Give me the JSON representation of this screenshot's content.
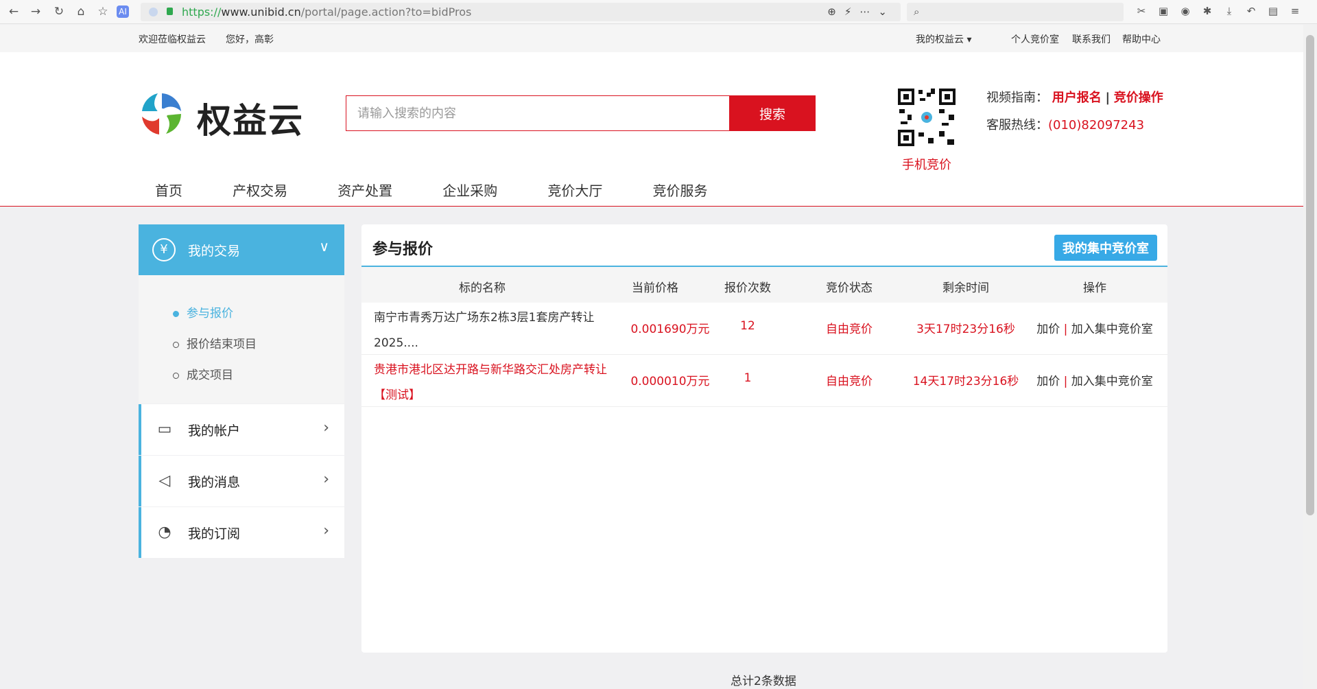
{
  "browser": {
    "url_scheme": "https://",
    "url_host": "www.unibid.cn",
    "url_path": "/portal/page.action?to=bidPros"
  },
  "topbar": {
    "welcome": "欢迎莅临权益云",
    "greeting": "您好，高彰",
    "my_cloud": "我的权益云",
    "links": [
      "个人竞价室",
      "联系我们",
      "帮助中心"
    ]
  },
  "header": {
    "logo_text": "权益云",
    "search_placeholder": "请输入搜索的内容",
    "search_button": "搜索",
    "qr_caption": "手机竞价",
    "guide_label": "视频指南：",
    "guide_link1": "用户报名",
    "guide_sep": "|",
    "guide_link2": "竞价操作",
    "hotline_label": "客服热线：",
    "hotline_number": "(010)82097243"
  },
  "nav": [
    "首页",
    "产权交易",
    "资产处置",
    "企业采购",
    "竞价大厅",
    "竞价服务"
  ],
  "sidebar": {
    "section_title": "我的交易",
    "sub_items": [
      "参与报价",
      "报价结束项目",
      "成交项目"
    ],
    "rows": [
      "我的帐户",
      "我的消息",
      "我的订阅"
    ]
  },
  "panel": {
    "title": "参与报价",
    "button": "我的集中竞价室",
    "columns": [
      "标的名称",
      "当前价格",
      "报价次数",
      "竞价状态",
      "剩余时间",
      "操作"
    ],
    "rows": [
      {
        "name": "南宁市青秀万达广场东2栋3层1套房产转让2025....",
        "price": "0.001690万元",
        "count": "12",
        "status": "自由竞价",
        "remaining": "3天17时23分16秒",
        "op1": "加价",
        "sep": "|",
        "op2": "加入集中竞价室"
      },
      {
        "name": "贵港市港北区达开路与新华路交汇处房产转让【测试】",
        "price": "0.000010万元",
        "count": "1",
        "status": "自由竞价",
        "remaining": "14天17时23分16秒",
        "op1": "加价",
        "sep": "|",
        "op2": "加入集中竞价室"
      }
    ]
  },
  "footer": {
    "total": "总计2条数据"
  }
}
